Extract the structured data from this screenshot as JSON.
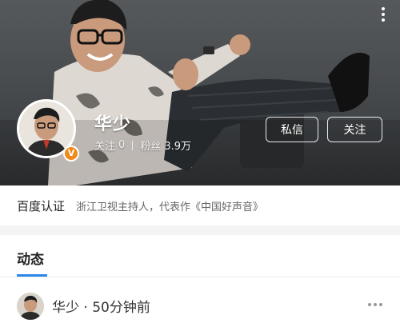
{
  "profile": {
    "name": "华少",
    "follow_label": "关注",
    "follow_count": "0",
    "fans_label": "粉丝",
    "fans_count": "3.9万",
    "badge": "V"
  },
  "actions": {
    "message_label": "私信",
    "follow_label": "关注"
  },
  "verification": {
    "label": "百度认证",
    "description": "浙江卫视主持人，代表作《中国好声音》"
  },
  "tabs": {
    "dynamics_label": "动态"
  },
  "post": {
    "author": "华少",
    "separator": "·",
    "time": "50分钟前"
  },
  "icons": {
    "top_right": "more-vertical-icon",
    "post_menu": "more-horizontal-icon"
  },
  "colors": {
    "accent": "#2e87e8",
    "badge": "#f08a1c"
  }
}
